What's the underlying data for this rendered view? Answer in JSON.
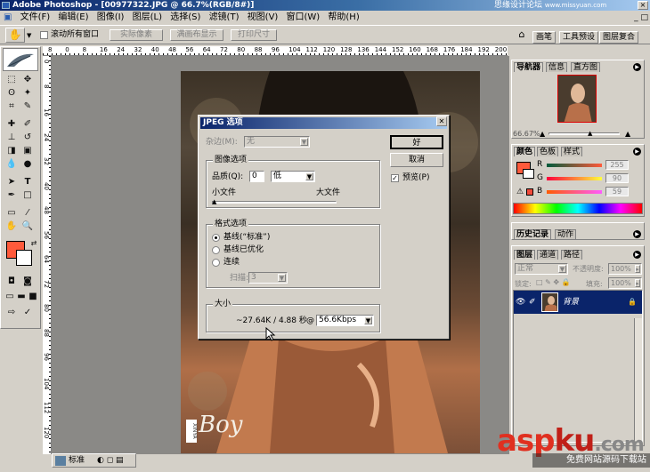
{
  "window": {
    "title": "Adobe Photoshop - [00977322.JPG @ 66.7%(RGB/8#)]",
    "watermark": "思缘设计论坛",
    "watermark_url": "www.missyuan.com",
    "min": "_",
    "max": "□",
    "close": "×"
  },
  "menubar": {
    "items": [
      "文件(F)",
      "编辑(E)",
      "图像(I)",
      "图层(L)",
      "选择(S)",
      "滤镜(T)",
      "视图(V)",
      "窗口(W)",
      "帮助(H)"
    ]
  },
  "options": {
    "scroll_all_label": "滚动所有窗口",
    "actual_pixels": "实际像素",
    "fit_screen": "满画布显示",
    "print_size": "打印尺寸",
    "well_tabs": [
      "画笔",
      "工具预设",
      "图层复合"
    ]
  },
  "dialog": {
    "title": "JPEG 选项",
    "matte_label": "杂边(M):",
    "matte_value": "无",
    "image_options_label": "图像选项",
    "quality_label": "品质(Q):",
    "quality_value": "0",
    "quality_preset": "低",
    "small_file": "小文件",
    "large_file": "大文件",
    "format_options_label": "格式选项",
    "formats": [
      "基线(“标准”)",
      "基线已优化",
      "连续"
    ],
    "scans_label": "扫描:",
    "scans_value": "3",
    "size_label": "大小",
    "size_value": "~27.64K / 4.88 秒",
    "at_sign": "@",
    "speed": "56.6Kbps",
    "ok": "好",
    "cancel": "取消",
    "preview": "预览(P)"
  },
  "navigator": {
    "tabs": [
      "导航器",
      "信息",
      "直方图"
    ],
    "zoom": "66.67%"
  },
  "color_panel": {
    "tabs": [
      "颜色",
      "色板",
      "样式"
    ],
    "channels": [
      {
        "label": "R",
        "value": "255"
      },
      {
        "label": "G",
        "value": "90"
      },
      {
        "label": "B",
        "value": "59"
      }
    ],
    "foreground": "#ff5a3b",
    "background": "#ffffff"
  },
  "history_panel": {
    "tabs": [
      "历史记录",
      "动作"
    ]
  },
  "layers_panel": {
    "tabs": [
      "图层",
      "通道",
      "路径"
    ],
    "blend_mode": "正常",
    "opacity_label": "不透明度:",
    "opacity_value": "100%",
    "lock_label": "锁定:",
    "fill_label": "填充:",
    "fill_value": "100%",
    "layer_name": "背景",
    "lock_icon": "🔒"
  },
  "ruler": {
    "top": [
      "8",
      "0",
      "8",
      "16",
      "24",
      "32",
      "40",
      "48",
      "56",
      "64",
      "72",
      "80",
      "88",
      "96",
      "104",
      "112",
      "120",
      "128",
      "136",
      "144",
      "152",
      "160",
      "168",
      "176",
      "184",
      "192",
      "200"
    ],
    "left": [
      "0",
      "8",
      "16",
      "24",
      "32",
      "40",
      "48",
      "56",
      "64",
      "72",
      "80",
      "88",
      "96",
      "104",
      "112",
      "120"
    ]
  },
  "image": {
    "logo_text": "Boy",
    "logo_tag": "XINYA"
  },
  "status": {
    "mode": "标准"
  },
  "branding": {
    "aspku_asp": "asp",
    "aspku_ku": "ku",
    "aspku_dot": ".com",
    "footer": "免费网站源码下载站"
  },
  "colors": {
    "title_gradient_start": "#0a246a",
    "title_gradient_end": "#a6caf0",
    "chrome": "#d4d0c8",
    "layer_selected": "#0a246a"
  }
}
